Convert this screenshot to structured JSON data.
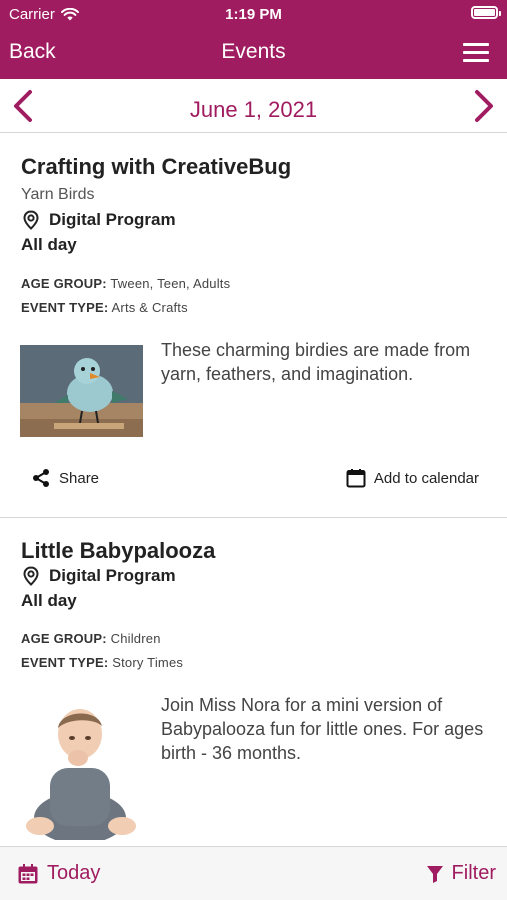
{
  "status_bar": {
    "carrier": "Carrier",
    "time": "1:19 PM"
  },
  "nav": {
    "back_label": "Back",
    "title": "Events"
  },
  "date_nav": {
    "date": "June 1, 2021"
  },
  "events": [
    {
      "title": "Crafting with CreativeBug",
      "subtitle": "Yarn Birds",
      "location": "Digital Program",
      "time": "All day",
      "age_group_label": "AGE GROUP:",
      "age_group": "Tween, Teen, Adults",
      "event_type_label": "EVENT TYPE:",
      "event_type": "Arts & Crafts",
      "description": "These charming birdies are made from yarn, feathers, and imagination.",
      "share_label": "Share",
      "calendar_label": "Add to calendar"
    },
    {
      "title": "Little Babypalooza",
      "location": "Digital Program",
      "time": "All day",
      "age_group_label": "AGE GROUP:",
      "age_group": "Children",
      "event_type_label": "EVENT TYPE:",
      "event_type": "Story Times",
      "description": "Join Miss Nora for a mini version of Babypalooza fun for little ones. For ages birth - 36 months."
    }
  ],
  "bottom_bar": {
    "today_label": "Today",
    "filter_label": "Filter"
  },
  "colors": {
    "brand": "#a01c60",
    "divider": "#d6d6d6",
    "bottom_bar_bg": "#f6f6f6"
  },
  "icons": [
    "wifi-icon",
    "battery-icon",
    "hamburger-menu-icon",
    "chevron-left-icon",
    "chevron-right-icon",
    "location-pin-icon",
    "share-icon",
    "calendar-icon",
    "filter-icon"
  ]
}
